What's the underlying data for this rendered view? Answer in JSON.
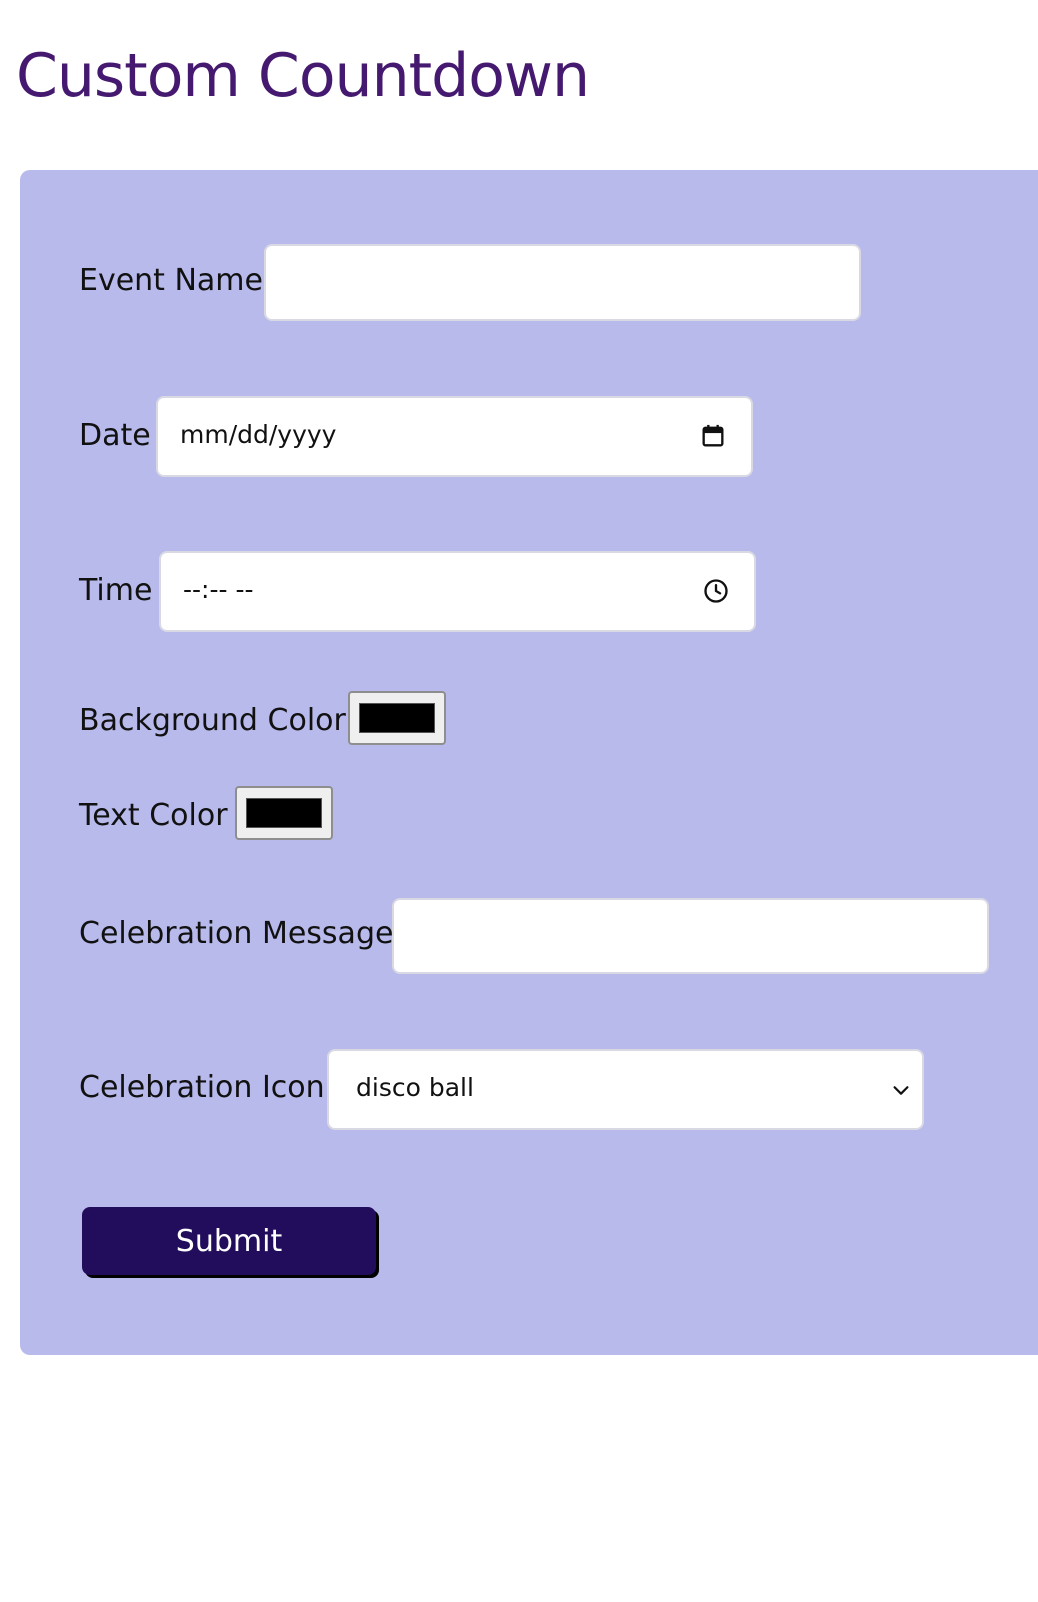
{
  "page": {
    "title": "Custom Countdown"
  },
  "form": {
    "event_name": {
      "label": "Event Name",
      "value": ""
    },
    "date": {
      "label": "Date",
      "placeholder": "mm/dd/yyyy",
      "icon": "calendar-icon"
    },
    "time": {
      "label": "Time",
      "placeholder": "--:-- --",
      "icon": "clock-icon"
    },
    "background_color": {
      "label": "Background Color",
      "value": "#000000"
    },
    "text_color": {
      "label": "Text Color",
      "value": "#000000"
    },
    "celebration_message": {
      "label": "Celebration Message",
      "value": ""
    },
    "celebration_icon": {
      "label": "Celebration Icon",
      "selected": "disco ball",
      "icon": "chevron-down-icon"
    },
    "submit_label": "Submit"
  },
  "colors": {
    "title": "#44196f",
    "panel": "#b8baec",
    "button": "#220d5c"
  }
}
